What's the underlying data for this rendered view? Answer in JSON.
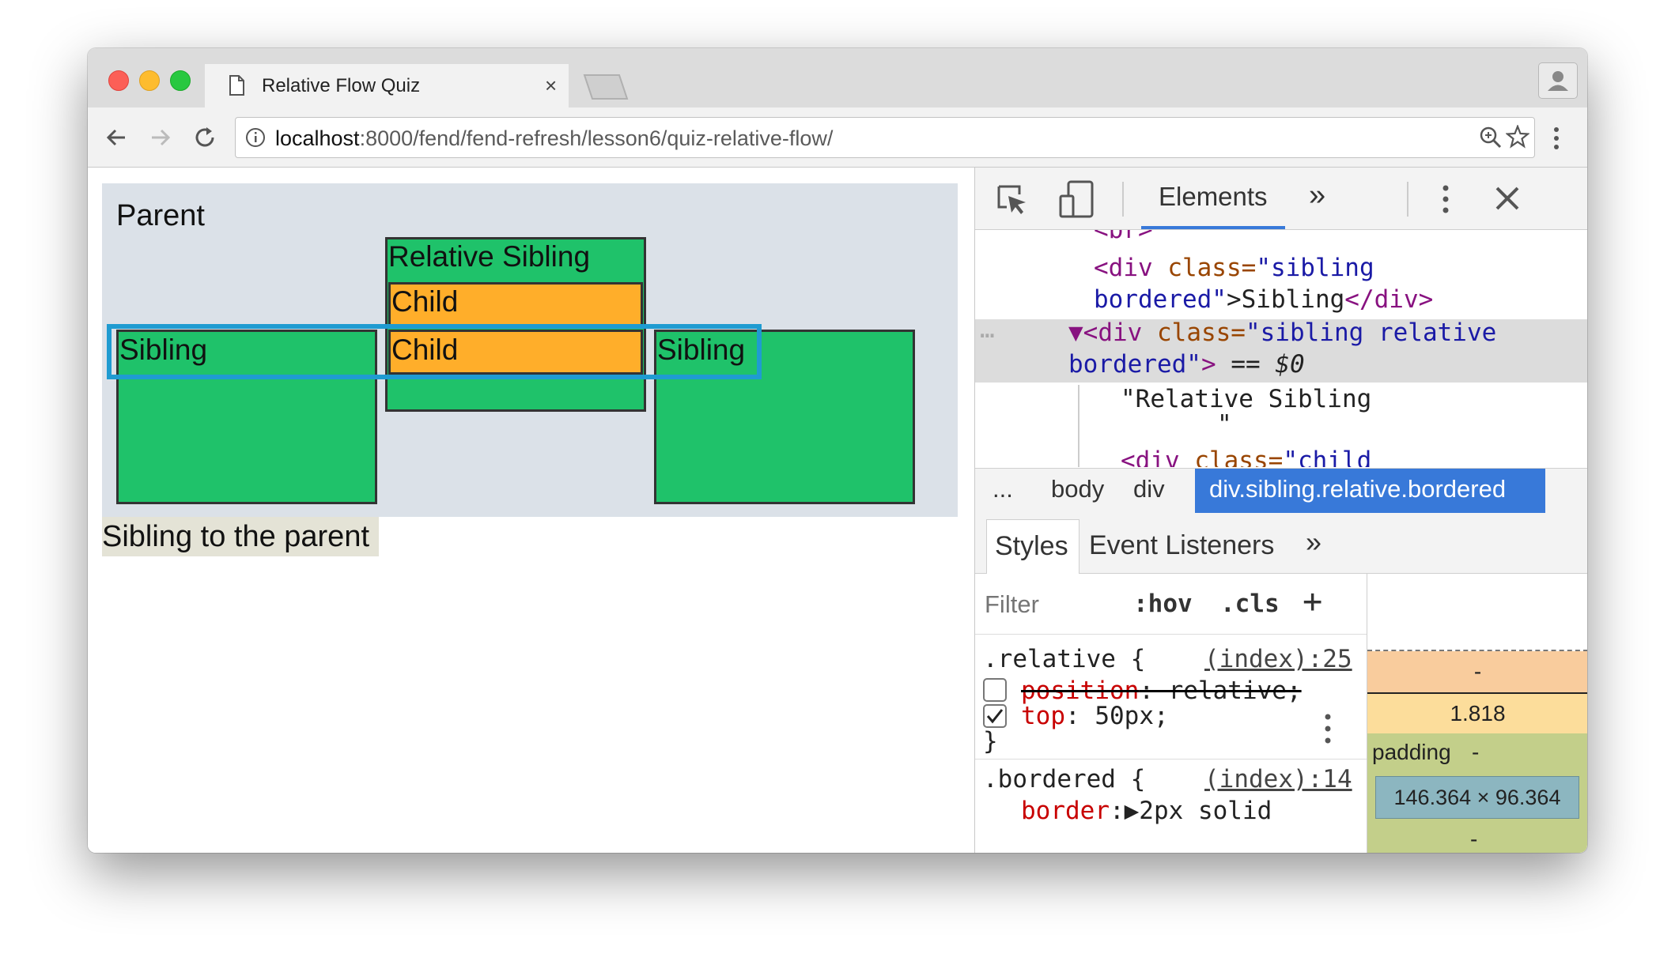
{
  "browser": {
    "tab_title": "Relative Flow Quiz",
    "tab_close": "×",
    "url_host": "localhost",
    "url_path": ":8000/fend/fend-refresh/lesson6/quiz-relative-flow/"
  },
  "page": {
    "parent_label": "Parent",
    "relative_sibling_label": "Relative Sibling",
    "child_label_1": "Child",
    "child_label_2": "Child",
    "sibling_left_label": "Sibling",
    "sibling_right_label": "Sibling",
    "sibling_to_parent": "Sibling to the parent"
  },
  "devtools": {
    "tab_elements": "Elements",
    "more_tabs": "»",
    "dom": {
      "l0": "<br>",
      "l1_open": "<div",
      "l1_attr": " class=",
      "l1_val": "\"sibling",
      "l2_val": "bordered\"",
      "l2_text": ">Sibling",
      "l2_close": "</div>",
      "l3_ell": "…",
      "l3_open": "▼<div",
      "l3_attr": " class=",
      "l3_val": "\"sibling relative",
      "l4_val": "bordered\"",
      "l4_gt": ">",
      "l4_eq": " == ",
      "l4_sel": "$0",
      "l5_text": "\"Relative Sibling",
      "l6_text": "\"",
      "l7_open": "<div",
      "l7_attr": " class=",
      "l7_val": "\"child"
    },
    "breadcrumbs": [
      "...",
      "body",
      "div",
      "div.sibling.relative.bordered"
    ],
    "subtabs": {
      "styles": "Styles",
      "listeners": "Event Listeners",
      "more": "»"
    },
    "filter": {
      "placeholder": "Filter",
      "hov": ":hov",
      "cls": ".cls",
      "add": "+"
    },
    "rules": {
      "r1_selector": ".relative {",
      "r1_source": "(index):25",
      "r1_p1_name": "position",
      "r1_p1_value": ": relative;",
      "r1_p2_name": "top",
      "r1_p2_value": ": 50px;",
      "r1_close": "}",
      "r2_selector": ".bordered {",
      "r2_source": "(index):14",
      "r2_p1_name": "border",
      "r2_p1_value": ":▶2px solid"
    },
    "box_model": {
      "margin_value": "-",
      "border_value": "1.818",
      "padding_label": "padding",
      "padding_value": "-",
      "content_size": "146.364 × 96.364",
      "padding_bottom": "-"
    }
  },
  "colors": {
    "sibling_green": "#1fc26a",
    "child_orange": "#ffae2a",
    "parent_bg": "#dbe1e8",
    "highlight_blue": "#1f9bd1",
    "selected_crumb": "#3879d9"
  }
}
